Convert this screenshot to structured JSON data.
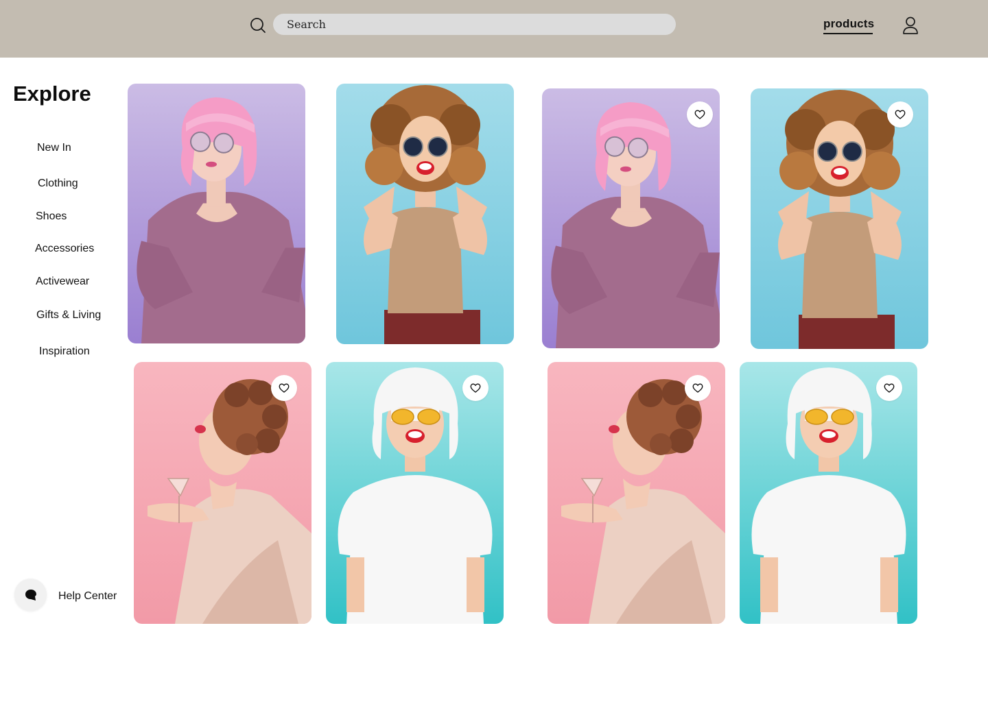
{
  "header": {
    "search_placeholder": "Search",
    "nav_label": "products"
  },
  "sidebar": {
    "title": "Explore",
    "items": [
      {
        "label": "New In"
      },
      {
        "label": "Clothing"
      },
      {
        "label": "Shoes"
      },
      {
        "label": "Accessories"
      },
      {
        "label": "Activewear"
      },
      {
        "label": "Gifts & Living"
      },
      {
        "label": "Inspiration"
      }
    ],
    "help_label": "Help Center"
  },
  "colors": {
    "header_bg": "#c3bcb1",
    "search_bg": "#dcdcdc",
    "lavender": "#c7b5e3",
    "sky_blue": "#8fd3e3",
    "pink": "#f6a9b3",
    "turquoise": "#6fd4d8"
  },
  "products": [
    {
      "image": "pink-wig-sweater-woman",
      "favorite_visible": false
    },
    {
      "image": "curly-hair-sunglasses-woman",
      "favorite_visible": false
    },
    {
      "image": "pink-wig-sweater-woman",
      "favorite_visible": true
    },
    {
      "image": "curly-hair-sunglasses-woman",
      "favorite_visible": true
    },
    {
      "image": "curlers-cocktail-woman",
      "favorite_visible": true
    },
    {
      "image": "white-wig-tshirt-woman",
      "favorite_visible": true
    },
    {
      "image": "curlers-cocktail-woman",
      "favorite_visible": true
    },
    {
      "image": "white-wig-tshirt-woman",
      "favorite_visible": true
    }
  ]
}
